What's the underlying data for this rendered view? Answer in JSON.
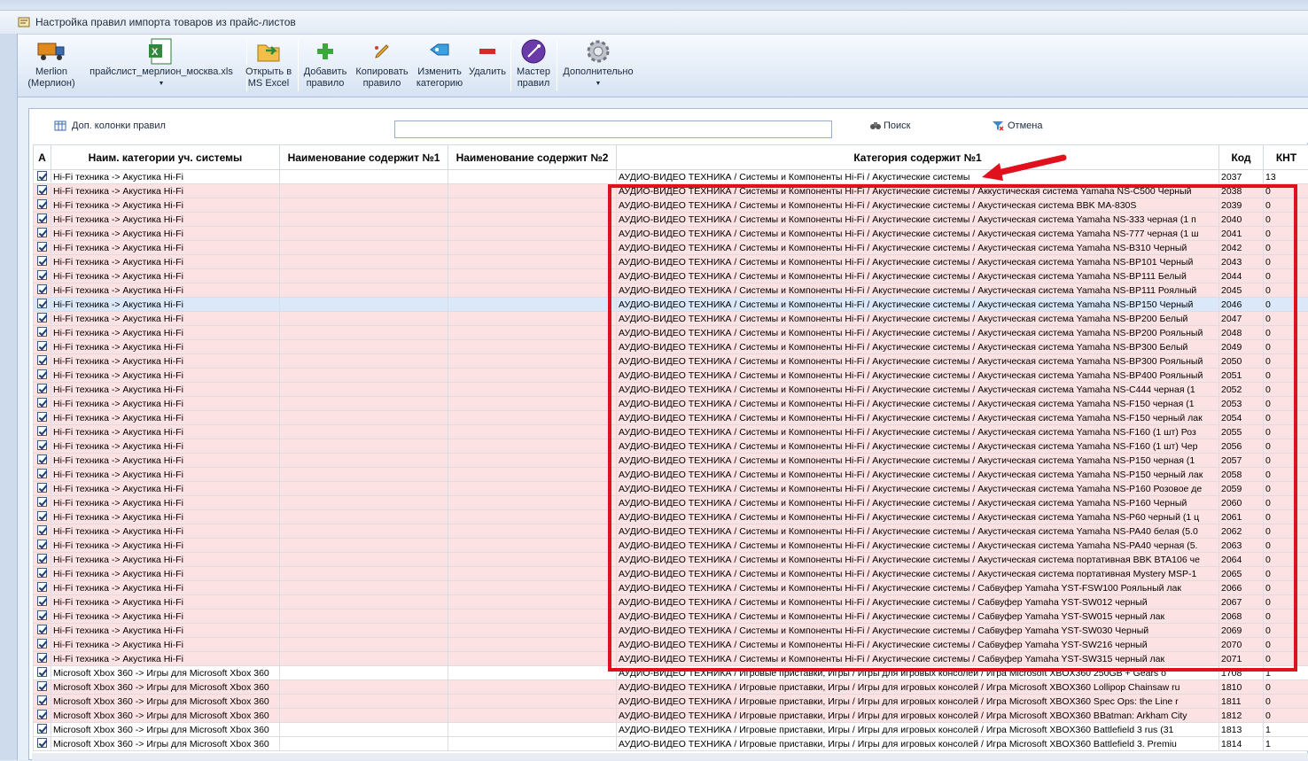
{
  "window": {
    "title": "Настройка правил импорта товаров из прайс-листов"
  },
  "toolbar": {
    "supplier": "Merlion (Мерлион)",
    "supplier_line1": "Merlion",
    "supplier_line2": "(Мерлион)",
    "pricelist": "прайслист_мерлион_москва.xls",
    "open_excel_1": "Открыть в",
    "open_excel_2": "MS Excel",
    "add_1": "Добавить",
    "add_2": "правило",
    "copy_1": "Копировать",
    "copy_2": "правило",
    "edit_1": "Изменить",
    "edit_2": "категорию",
    "delete": "Удалить",
    "wizard_1": "Мастер",
    "wizard_2": "правил",
    "more": "Дополнительно"
  },
  "filter": {
    "extra_columns": "Доп. колонки правил",
    "search_value": "",
    "search_button": "Поиск",
    "cancel_button": "Отмена"
  },
  "columns": [
    "А",
    "Наим. категории уч. системы",
    "Наименование содержит №1",
    "Наименование содержит №2",
    "Категория содержит №1",
    "Код",
    "КНТ"
  ],
  "rows": [
    {
      "cat": "Hi-Fi техника -> Акустика Hi-Fi",
      "c1": "АУДИО-ВИДЕО ТЕХНИКА / Системы и Компоненты Hi-Fi / Акустические системы",
      "code": "2037",
      "knt": "13",
      "style": "white"
    },
    {
      "cat": "Hi-Fi техника -> Акустика Hi-Fi",
      "c1": "АУДИО-ВИДЕО ТЕХНИКА / Системы и Компоненты Hi-Fi / Акустические системы / Аккустическая система Yamaha NS-C500 Черный",
      "code": "2038",
      "knt": "0",
      "style": "pink"
    },
    {
      "cat": "Hi-Fi техника -> Акустика Hi-Fi",
      "c1": "АУДИО-ВИДЕО ТЕХНИКА / Системы и Компоненты Hi-Fi / Акустические системы / Акустическая система BBK MA-830S",
      "code": "2039",
      "knt": "0",
      "style": "pink"
    },
    {
      "cat": "Hi-Fi техника -> Акустика Hi-Fi",
      "c1": "АУДИО-ВИДЕО ТЕХНИКА / Системы и Компоненты Hi-Fi / Акустические системы / Акустическая система Yamaha NS-333 черная (1 п",
      "code": "2040",
      "knt": "0",
      "style": "pink"
    },
    {
      "cat": "Hi-Fi техника -> Акустика Hi-Fi",
      "c1": "АУДИО-ВИДЕО ТЕХНИКА / Системы и Компоненты Hi-Fi / Акустические системы / Акустическая система Yamaha NS-777 черная (1 ш",
      "code": "2041",
      "knt": "0",
      "style": "pink"
    },
    {
      "cat": "Hi-Fi техника -> Акустика Hi-Fi",
      "c1": "АУДИО-ВИДЕО ТЕХНИКА / Системы и Компоненты Hi-Fi / Акустические системы / Акустическая система Yamaha NS-B310 Черный",
      "code": "2042",
      "knt": "0",
      "style": "pink"
    },
    {
      "cat": "Hi-Fi техника -> Акустика Hi-Fi",
      "c1": "АУДИО-ВИДЕО ТЕХНИКА / Системы и Компоненты Hi-Fi / Акустические системы / Акустическая система Yamaha NS-BP101 Черный",
      "code": "2043",
      "knt": "0",
      "style": "pink"
    },
    {
      "cat": "Hi-Fi техника -> Акустика Hi-Fi",
      "c1": "АУДИО-ВИДЕО ТЕХНИКА / Системы и Компоненты Hi-Fi / Акустические системы / Акустическая система Yamaha NS-BP111 Белый",
      "code": "2044",
      "knt": "0",
      "style": "pink"
    },
    {
      "cat": "Hi-Fi техника -> Акустика Hi-Fi",
      "c1": "АУДИО-ВИДЕО ТЕХНИКА / Системы и Компоненты Hi-Fi / Акустические системы / Акустическая система Yamaha NS-BP111 Роялный",
      "code": "2045",
      "knt": "0",
      "style": "pink"
    },
    {
      "cat": "Hi-Fi техника -> Акустика Hi-Fi",
      "c1": "АУДИО-ВИДЕО ТЕХНИКА / Системы и Компоненты Hi-Fi / Акустические системы / Акустическая система Yamaha NS-BP150 Черный",
      "code": "2046",
      "knt": "0",
      "style": "sel"
    },
    {
      "cat": "Hi-Fi техника -> Акустика Hi-Fi",
      "c1": "АУДИО-ВИДЕО ТЕХНИКА / Системы и Компоненты Hi-Fi / Акустические системы / Акустическая система Yamaha NS-BP200 Белый",
      "code": "2047",
      "knt": "0",
      "style": "pink"
    },
    {
      "cat": "Hi-Fi техника -> Акустика Hi-Fi",
      "c1": "АУДИО-ВИДЕО ТЕХНИКА / Системы и Компоненты Hi-Fi / Акустические системы / Акустическая система Yamaha NS-BP200 Рояльный",
      "code": "2048",
      "knt": "0",
      "style": "pink"
    },
    {
      "cat": "Hi-Fi техника -> Акустика Hi-Fi",
      "c1": "АУДИО-ВИДЕО ТЕХНИКА / Системы и Компоненты Hi-Fi / Акустические системы / Акустическая система Yamaha NS-BP300 Белый",
      "code": "2049",
      "knt": "0",
      "style": "pink"
    },
    {
      "cat": "Hi-Fi техника -> Акустика Hi-Fi",
      "c1": "АУДИО-ВИДЕО ТЕХНИКА / Системы и Компоненты Hi-Fi / Акустические системы / Акустическая система Yamaha NS-BP300 Рояльный",
      "code": "2050",
      "knt": "0",
      "style": "pink"
    },
    {
      "cat": "Hi-Fi техника -> Акустика Hi-Fi",
      "c1": "АУДИО-ВИДЕО ТЕХНИКА / Системы и Компоненты Hi-Fi / Акустические системы / Акустическая система Yamaha NS-BP400 Рояльный",
      "code": "2051",
      "knt": "0",
      "style": "pink"
    },
    {
      "cat": "Hi-Fi техника -> Акустика Hi-Fi",
      "c1": "АУДИО-ВИДЕО ТЕХНИКА / Системы и Компоненты Hi-Fi / Акустические системы / Акустическая система Yamaha NS-C444 черная (1",
      "code": "2052",
      "knt": "0",
      "style": "pink"
    },
    {
      "cat": "Hi-Fi техника -> Акустика Hi-Fi",
      "c1": "АУДИО-ВИДЕО ТЕХНИКА / Системы и Компоненты Hi-Fi / Акустические системы / Акустическая система Yamaha NS-F150 черная (1",
      "code": "2053",
      "knt": "0",
      "style": "pink"
    },
    {
      "cat": "Hi-Fi техника -> Акустика Hi-Fi",
      "c1": "АУДИО-ВИДЕО ТЕХНИКА / Системы и Компоненты Hi-Fi / Акустические системы / Акустическая система Yamaha NS-F150 черный лак",
      "code": "2054",
      "knt": "0",
      "style": "pink"
    },
    {
      "cat": "Hi-Fi техника -> Акустика Hi-Fi",
      "c1": "АУДИО-ВИДЕО ТЕХНИКА / Системы и Компоненты Hi-Fi / Акустические системы / Акустическая система Yamaha NS-F160 (1 шт) Роз",
      "code": "2055",
      "knt": "0",
      "style": "pink"
    },
    {
      "cat": "Hi-Fi техника -> Акустика Hi-Fi",
      "c1": "АУДИО-ВИДЕО ТЕХНИКА / Системы и Компоненты Hi-Fi / Акустические системы / Акустическая система Yamaha NS-F160 (1 шт) Чер",
      "code": "2056",
      "knt": "0",
      "style": "pink"
    },
    {
      "cat": "Hi-Fi техника -> Акустика Hi-Fi",
      "c1": "АУДИО-ВИДЕО ТЕХНИКА / Системы и Компоненты Hi-Fi / Акустические системы / Акустическая система Yamaha NS-P150 черная (1",
      "code": "2057",
      "knt": "0",
      "style": "pink"
    },
    {
      "cat": "Hi-Fi техника -> Акустика Hi-Fi",
      "c1": "АУДИО-ВИДЕО ТЕХНИКА / Системы и Компоненты Hi-Fi / Акустические системы / Акустическая система Yamaha NS-P150 черный лак",
      "code": "2058",
      "knt": "0",
      "style": "pink"
    },
    {
      "cat": "Hi-Fi техника -> Акустика Hi-Fi",
      "c1": "АУДИО-ВИДЕО ТЕХНИКА / Системы и Компоненты Hi-Fi / Акустические системы / Акустическая система Yamaha NS-P160 Розовое де",
      "code": "2059",
      "knt": "0",
      "style": "pink"
    },
    {
      "cat": "Hi-Fi техника -> Акустика Hi-Fi",
      "c1": "АУДИО-ВИДЕО ТЕХНИКА / Системы и Компоненты Hi-Fi / Акустические системы / Акустическая система Yamaha NS-P160 Черный",
      "code": "2060",
      "knt": "0",
      "style": "pink"
    },
    {
      "cat": "Hi-Fi техника -> Акустика Hi-Fi",
      "c1": "АУДИО-ВИДЕО ТЕХНИКА / Системы и Компоненты Hi-Fi / Акустические системы / Акустическая система Yamaha NS-P60 черный (1 ц",
      "code": "2061",
      "knt": "0",
      "style": "pink"
    },
    {
      "cat": "Hi-Fi техника -> Акустика Hi-Fi",
      "c1": "АУДИО-ВИДЕО ТЕХНИКА / Системы и Компоненты Hi-Fi / Акустические системы / Акустическая система Yamaha NS-PA40 белая (5.0",
      "code": "2062",
      "knt": "0",
      "style": "pink"
    },
    {
      "cat": "Hi-Fi техника -> Акустика Hi-Fi",
      "c1": "АУДИО-ВИДЕО ТЕХНИКА / Системы и Компоненты Hi-Fi / Акустические системы / Акустическая система Yamaha NS-PA40 черная (5.",
      "code": "2063",
      "knt": "0",
      "style": "pink"
    },
    {
      "cat": "Hi-Fi техника -> Акустика Hi-Fi",
      "c1": "АУДИО-ВИДЕО ТЕХНИКА / Системы и Компоненты Hi-Fi / Акустические системы / Акустическая система портативная BBK BTA106 че",
      "code": "2064",
      "knt": "0",
      "style": "pink"
    },
    {
      "cat": "Hi-Fi техника -> Акустика Hi-Fi",
      "c1": "АУДИО-ВИДЕО ТЕХНИКА / Системы и Компоненты Hi-Fi / Акустические системы / Акустическая система портативная Mystery MSP-1",
      "code": "2065",
      "knt": "0",
      "style": "pink"
    },
    {
      "cat": "Hi-Fi техника -> Акустика Hi-Fi",
      "c1": "АУДИО-ВИДЕО ТЕХНИКА / Системы и Компоненты Hi-Fi / Акустические системы / Сабвуфер Yamaha YST-FSW100 Рояльный лак",
      "code": "2066",
      "knt": "0",
      "style": "pink"
    },
    {
      "cat": "Hi-Fi техника -> Акустика Hi-Fi",
      "c1": "АУДИО-ВИДЕО ТЕХНИКА / Системы и Компоненты Hi-Fi / Акустические системы / Сабвуфер Yamaha YST-SW012 черный",
      "code": "2067",
      "knt": "0",
      "style": "pink"
    },
    {
      "cat": "Hi-Fi техника -> Акустика Hi-Fi",
      "c1": "АУДИО-ВИДЕО ТЕХНИКА / Системы и Компоненты Hi-Fi / Акустические системы / Сабвуфер Yamaha YST-SW015 черный лак",
      "code": "2068",
      "knt": "0",
      "style": "pink"
    },
    {
      "cat": "Hi-Fi техника -> Акустика Hi-Fi",
      "c1": "АУДИО-ВИДЕО ТЕХНИКА / Системы и Компоненты Hi-Fi / Акустические системы / Сабвуфер Yamaha YST-SW030 Черный",
      "code": "2069",
      "knt": "0",
      "style": "pink"
    },
    {
      "cat": "Hi-Fi техника -> Акустика Hi-Fi",
      "c1": "АУДИО-ВИДЕО ТЕХНИКА / Системы и Компоненты Hi-Fi / Акустические системы / Сабвуфер Yamaha YST-SW216 черный",
      "code": "2070",
      "knt": "0",
      "style": "pink"
    },
    {
      "cat": "Hi-Fi техника -> Акустика Hi-Fi",
      "c1": "АУДИО-ВИДЕО ТЕХНИКА / Системы и Компоненты Hi-Fi / Акустические системы / Сабвуфер Yamaha YST-SW315 черный лак",
      "code": "2071",
      "knt": "0",
      "style": "pink"
    },
    {
      "cat": "Microsoft Xbox 360 -> Игры для Microsoft Xbox 360",
      "c1": "АУДИО-ВИДЕО ТЕХНИКА / Игровые приставки, Игры / Игры для игровых консолей / Игра Microsoft XBOX360 250GB + Gears o",
      "code": "1708",
      "knt": "1",
      "style": "white"
    },
    {
      "cat": "Microsoft Xbox 360 -> Игры для Microsoft Xbox 360",
      "c1": "АУДИО-ВИДЕО ТЕХНИКА / Игровые приставки, Игры / Игры для игровых консолей / Игра Microsoft XBOX360  Lollipop Chainsaw ru",
      "code": "1810",
      "knt": "0",
      "style": "pink"
    },
    {
      "cat": "Microsoft Xbox 360 -> Игры для Microsoft Xbox 360",
      "c1": "АУДИО-ВИДЕО ТЕХНИКА / Игровые приставки, Игры / Игры для игровых консолей / Игра Microsoft XBOX360  Spec Ops: the Line r",
      "code": "1811",
      "knt": "0",
      "style": "pink"
    },
    {
      "cat": "Microsoft Xbox 360 -> Игры для Microsoft Xbox 360",
      "c1": "АУДИО-ВИДЕО ТЕХНИКА / Игровые приставки, Игры / Игры для игровых консолей / Игра Microsoft XBOX360 BBatman: Arkham City",
      "code": "1812",
      "knt": "0",
      "style": "pink"
    },
    {
      "cat": "Microsoft Xbox 360 -> Игры для Microsoft Xbox 360",
      "c1": "АУДИО-ВИДЕО ТЕХНИКА / Игровые приставки, Игры / Игры для игровых консолей / Игра Microsoft XBOX360 Battlefield 3 rus (31",
      "code": "1813",
      "knt": "1",
      "style": "white"
    },
    {
      "cat": "Microsoft Xbox 360 -> Игры для Microsoft Xbox 360",
      "c1": "АУДИО-ВИДЕО ТЕХНИКА / Игровые приставки, Игры / Игры для игровых консолей / Игра Microsoft XBOX360 Battlefield 3. Premiu",
      "code": "1814",
      "knt": "1",
      "style": "white"
    }
  ],
  "colors": {
    "pink_row": "#fde2e4",
    "selected_row": "#dbe8fa",
    "highlight": "#e0101c"
  }
}
